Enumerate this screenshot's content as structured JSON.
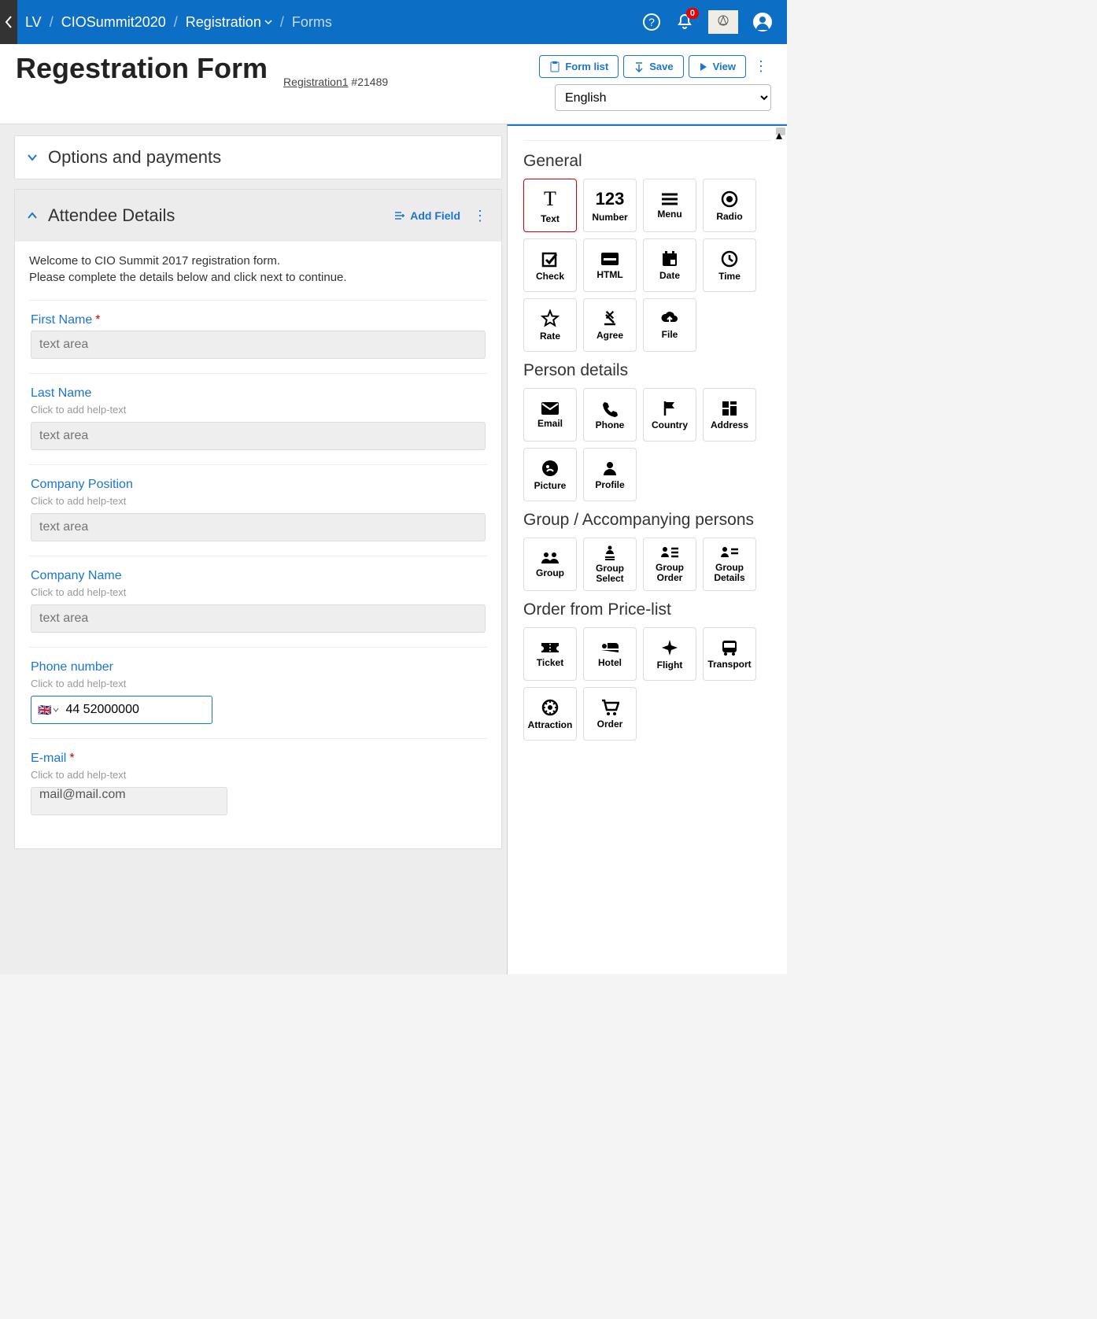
{
  "topbar": {
    "crumbs": [
      "LV",
      "CIOSummit2020",
      "Registration",
      "Forms"
    ],
    "notif_count": "0"
  },
  "header": {
    "title": "Regestration Form",
    "sub_link": "Registration1",
    "sub_tail": " #21489",
    "btn_formlist": "Form list",
    "btn_save": "Save",
    "btn_view": "View",
    "language": "English"
  },
  "panels": {
    "options_title": "Options and payments",
    "attendee_title": "Attendee Details",
    "add_field": "Add Field",
    "intro_l1": "Welcome to CIO Summit 2017 registration form.",
    "intro_l2": "Please complete the details below and click next to continue."
  },
  "fields": {
    "text_placeholder": "text area",
    "help_placeholder": "Click to add help-text",
    "first_name": "First Name",
    "last_name": "Last Name",
    "company_position": "Company Position",
    "company_name": "Company Name",
    "phone": "Phone number",
    "phone_value": "44 52000000",
    "email": "E-mail",
    "email_value": "mail@mail.com"
  },
  "side": {
    "general": "General",
    "person": "Person details",
    "group": "Group / Accompanying persons",
    "order": "Order from Price-list",
    "tiles_general": [
      "Text",
      "Number",
      "Menu",
      "Radio",
      "Check",
      "HTML",
      "Date",
      "Time",
      "Rate",
      "Agree",
      "File"
    ],
    "tiles_person": [
      "Email",
      "Phone",
      "Country",
      "Address",
      "Picture",
      "Profile"
    ],
    "tiles_group": [
      "Group",
      "Group Select",
      "Group Order",
      "Group Details"
    ],
    "tiles_order": [
      "Ticket",
      "Hotel",
      "Flight",
      "Transport",
      "Attraction",
      "Order"
    ]
  }
}
